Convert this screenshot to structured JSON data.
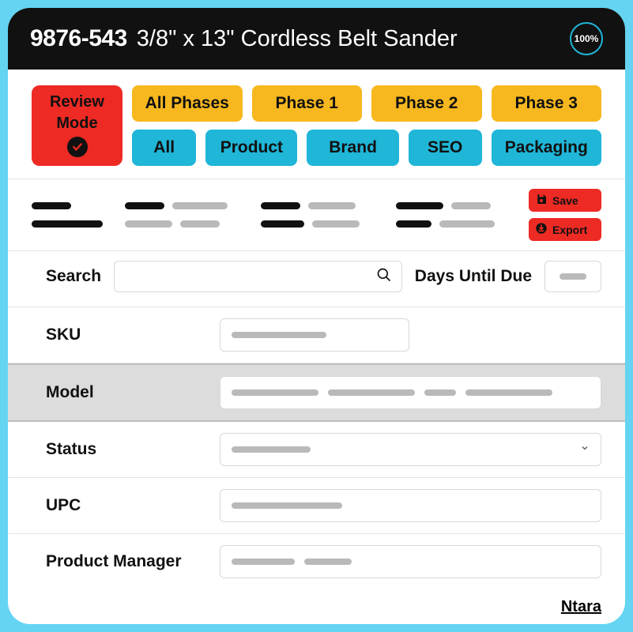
{
  "header": {
    "sku": "9876-543",
    "desc": "3/8\" x 13\" Cordless Belt Sander",
    "percent": "100%"
  },
  "review_mode": {
    "line1": "Review",
    "line2": "Mode"
  },
  "phase_tabs": [
    "All Phases",
    "Phase 1",
    "Phase 2",
    "Phase 3"
  ],
  "cat_tabs": [
    "All",
    "Product",
    "Brand",
    "SEO",
    "Packaging"
  ],
  "actions": {
    "save": "Save",
    "export": "Export"
  },
  "search": {
    "label": "Search",
    "due_label": "Days Until Due"
  },
  "fields": [
    {
      "label": "SKU",
      "size": "sm"
    },
    {
      "label": "Model",
      "size": "lg",
      "highlight": true
    },
    {
      "label": "Status",
      "size": "lg",
      "dropdown": true
    },
    {
      "label": "UPC",
      "size": "lg"
    },
    {
      "label": "Product Manager",
      "size": "lg"
    }
  ],
  "footer": "Ntara"
}
